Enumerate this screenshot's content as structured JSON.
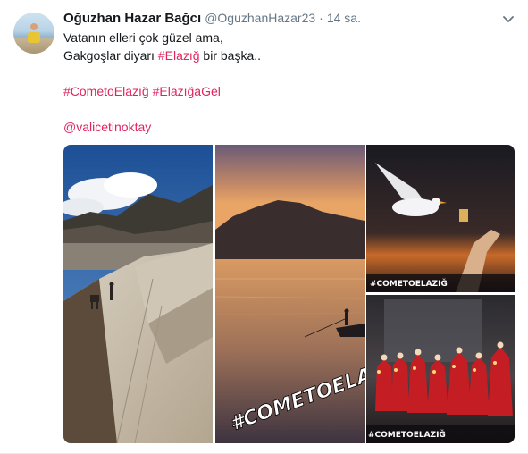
{
  "tweet": {
    "author_name": "Oğuzhan Hazar Bağcı",
    "handle": "@OguzhanHazar23",
    "separator": "·",
    "time": "14 sa.",
    "lines": [
      {
        "parts": [
          {
            "text": "Vatanın elleri çok güzel ama,",
            "type": "text"
          }
        ]
      },
      {
        "parts": [
          {
            "text": "Gakgoşlar diyarı ",
            "type": "text"
          },
          {
            "text": "#Elazığ",
            "type": "hashtag"
          },
          {
            "text": " bir başka..",
            "type": "text"
          }
        ]
      },
      {
        "parts": []
      },
      {
        "parts": [
          {
            "text": "#CometoElazığ",
            "type": "hashtag"
          },
          {
            "text": " ",
            "type": "text"
          },
          {
            "text": "#ElazığaGel",
            "type": "hashtag"
          }
        ]
      },
      {
        "parts": []
      },
      {
        "parts": [
          {
            "text": "@valicetinoktay",
            "type": "mention"
          }
        ]
      }
    ]
  },
  "media": {
    "image2_watermark": "#COMETOELAZ",
    "image3_caption": "#COMETOELAZIĞ",
    "image4_caption": "#COMETOELAZIĞ"
  },
  "colors": {
    "link": "#e0245e",
    "text": "#14171a",
    "muted": "#657786"
  },
  "icons": {
    "caret": "chevron-down-icon",
    "avatar": "avatar"
  }
}
